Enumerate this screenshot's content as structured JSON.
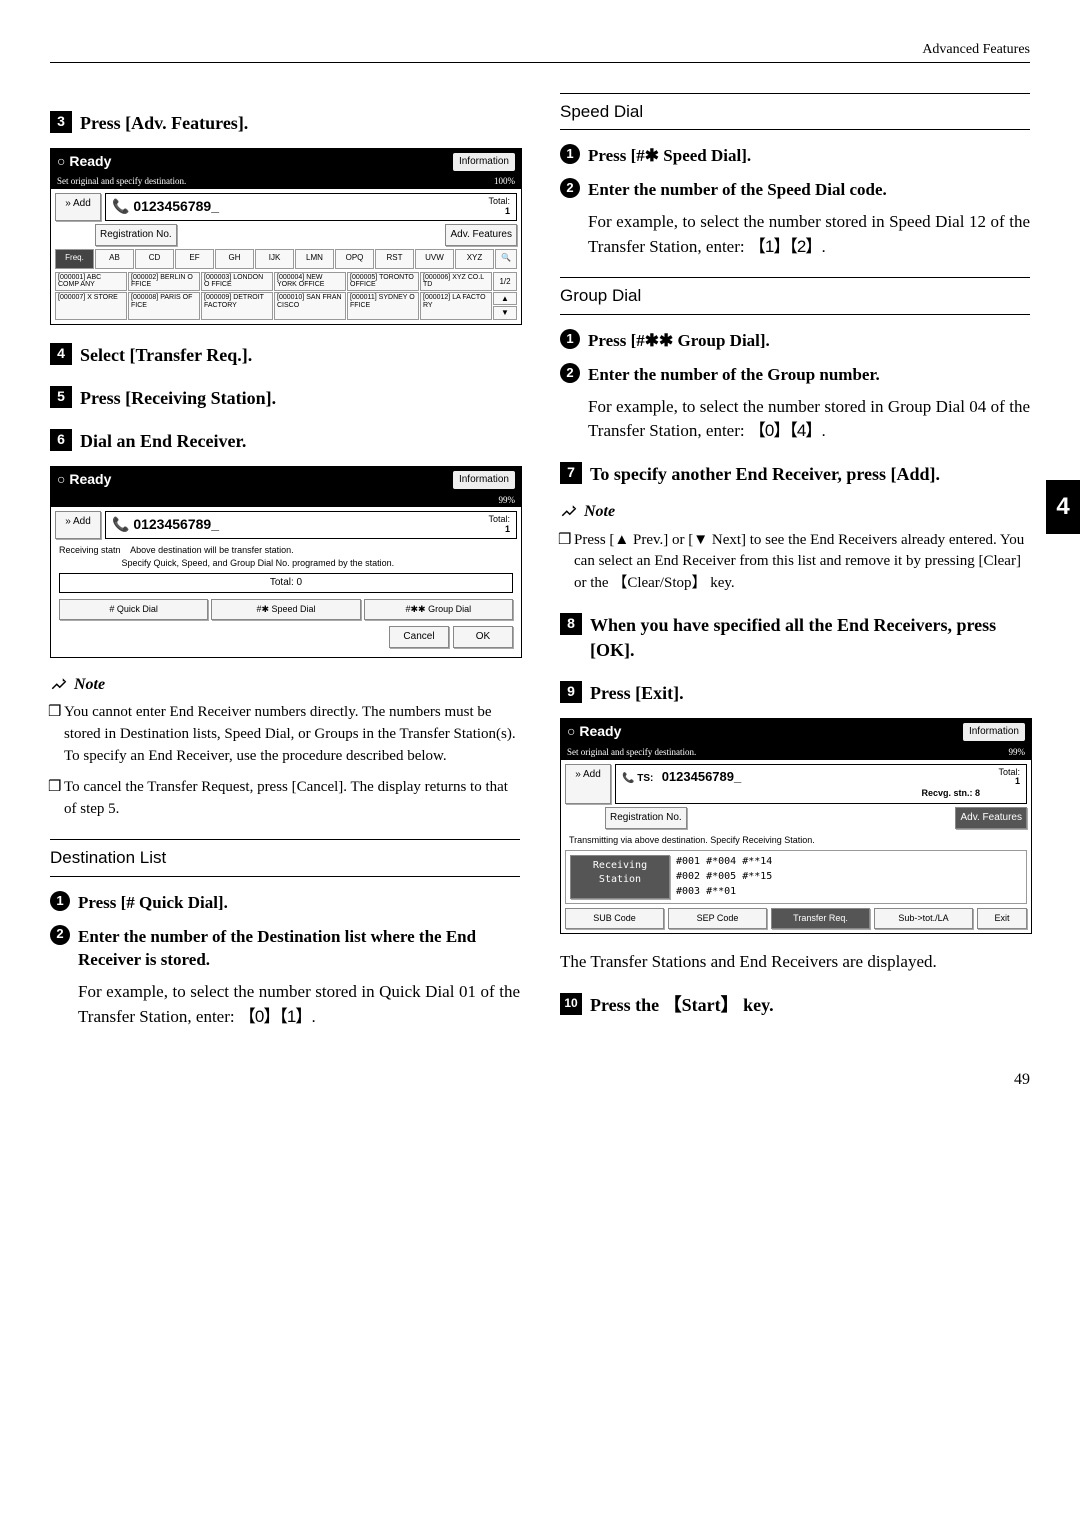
{
  "header_category": "Advanced Features",
  "page_number": "49",
  "chapter_tab": "4",
  "left": {
    "step3": "Press [Adv. Features].",
    "step4": "Select [Transfer Req.].",
    "step5": "Press [Receiving Station].",
    "step6": "Dial an End Receiver.",
    "note_title": "Note",
    "note_items": [
      "You cannot enter End Receiver numbers directly. The numbers must be stored in Destination lists, Speed Dial, or Groups in the Transfer Station(s). To specify an End Receiver, use the procedure described below.",
      "To cancel the Transfer Request, press [Cancel]. The display returns to that of step 5."
    ],
    "dest_list_title": "Destination List",
    "dest_step1": "Press [# Quick Dial].",
    "dest_step2": "Enter the number of the Destination list where the End Receiver is stored.",
    "dest_para": "For example, to select the number stored in Quick Dial 01 of the Transfer Station, enter:",
    "dest_keys": "【0】【1】."
  },
  "right": {
    "speed_title": "Speed Dial",
    "speed_step1": "Press [#✱ Speed Dial].",
    "speed_step2": "Enter the number of the Speed Dial code.",
    "speed_para": "For example, to select the number stored in Speed Dial 12 of the Transfer Station, enter:",
    "speed_keys": "【1】【2】.",
    "group_title": "Group Dial",
    "group_step1": "Press [#✱✱ Group Dial].",
    "group_step2": "Enter the number of the Group number.",
    "group_para": "For example, to select the number stored in Group Dial 04 of the Transfer Station, enter:",
    "group_keys": "【0】【4】.",
    "step7": "To specify another End Receiver, press [Add].",
    "note_title": "Note",
    "note_item": "Press [▲ Prev.] or [▼ Next] to see the End Receivers already entered. You can select an End Receiver from this list and remove it by pressing [Clear] or the 【Clear/Stop】 key.",
    "step8": "When you have specified all the End Receivers, press [OK].",
    "step9": "Press [Exit].",
    "closing_para": "The Transfer Stations and End Receivers are displayed.",
    "step10": "Press the 【Start】 key."
  },
  "scr1": {
    "title": "Ready",
    "info": "Information",
    "sub": "Set original and specify destination.",
    "pct": "100%",
    "add": "Add",
    "number": "0123456789_",
    "total_lbl": "Total:",
    "total_val": "1",
    "reg": "Registration No.",
    "adv": "Adv. Features",
    "tabs": [
      "Freq.",
      "AB",
      "CD",
      "EF",
      "GH",
      "IJK",
      "LMN",
      "OPQ",
      "RST",
      "UVW",
      "XYZ"
    ],
    "page": "1/2",
    "entries_top": [
      "[000001]\nABC COMP\nANY",
      "[000002]\nBERLIN O\nFFICE",
      "[000003]\nLONDON O\nFFICE",
      "[000004]\nNEW YORK\n OFFICE",
      "[000005]\nTORONTO\nOFFICE",
      "[000006]\nXYZ CO.L\nTD"
    ],
    "entries_bot": [
      "[000007]\nX STORE",
      "[000008]\nPARIS OF\nFICE",
      "[000009]\nDETROIT\nFACTORY",
      "[000010]\nSAN FRAN\nCISCO",
      "[000011]\nSYDNEY O\nFFICE",
      "[000012]\nLA FACTO\nRY"
    ]
  },
  "scr2": {
    "title": "Ready",
    "info": "Information",
    "pct": "99%",
    "add": "Add",
    "number": "0123456789_",
    "total_lbl": "Total:",
    "total_val": "1",
    "status": "Receiving statn",
    "status_msg1": "Above destination will be transfer station.",
    "status_msg2": "Specify Quick, Speed, and Group Dial No. programed by the station.",
    "total_mid": "Total:  0",
    "btns": [
      "# Quick Dial",
      "#✱ Speed Dial",
      "#✱✱ Group Dial"
    ],
    "cancel": "Cancel",
    "ok": "OK"
  },
  "scr3": {
    "title": "Ready",
    "info": "Information",
    "pct": "99%",
    "sub": "Set original and specify destination.",
    "add": "Add",
    "ts": "TS:",
    "number": "0123456789_",
    "total_lbl": "Total:",
    "total_val": "1",
    "recvg": "Recvg. stn.:  8",
    "reg": "Registration No.",
    "adv": "Adv. Features",
    "status": "Transmitting via above destination.  Specify Receiving Station.",
    "recv_btn": "Receiving Station",
    "col1": [
      "#001",
      "#002",
      "#003"
    ],
    "col2": [
      "#*004",
      "#*005",
      "#**01"
    ],
    "col3": [
      "#**14",
      "#**15"
    ],
    "bottom": [
      "SUB Code",
      "SEP Code",
      "Transfer Req.",
      "Sub->tot./LA",
      "Exit"
    ]
  }
}
